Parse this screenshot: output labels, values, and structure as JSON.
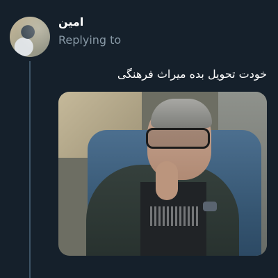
{
  "tweet": {
    "username": "امین",
    "replying_label": "Replying to",
    "text": "خودت تحویل بده میراث فرهنگی"
  },
  "colors": {
    "background": "#15202b",
    "secondary_text": "#8899a6",
    "thread_line": "#3d5466"
  }
}
